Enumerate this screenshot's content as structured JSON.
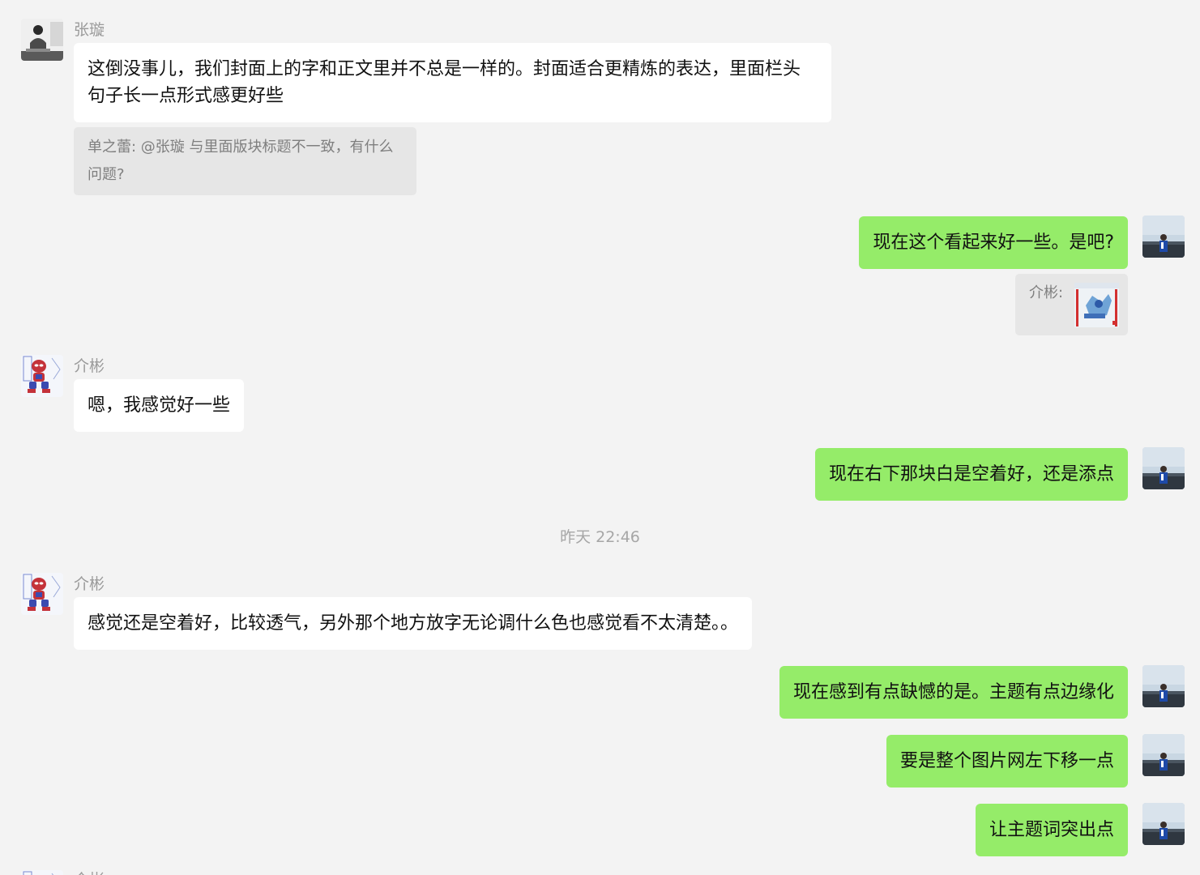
{
  "messages": {
    "m1": {
      "sender": "张璇",
      "text": "这倒没事儿，我们封面上的字和正文里并不总是一样的。封面适合更精炼的表达，里面栏头句子长一点形式感更好些"
    },
    "q1": {
      "text": "单之蕾: @张璇 与里面版块标题不一致，有什么问题?"
    },
    "m2": {
      "text": "现在这个看起来好一些。是吧?"
    },
    "q2": {
      "label": "介彬:"
    },
    "m3": {
      "sender": "介彬",
      "text": "嗯，我感觉好一些"
    },
    "m4": {
      "text": "现在右下那块白是空着好，还是添点"
    },
    "timestamp": "昨天 22:46",
    "m5": {
      "sender": "介彬",
      "text": "感觉还是空着好，比较透气，另外那个地方放字无论调什么色也感觉看不太清楚。。"
    },
    "m6": {
      "text": "现在感到有点缺憾的是。主题有点边缘化"
    },
    "m7": {
      "text": "要是整个图片网左下移一点"
    },
    "m8": {
      "text": "让主题词突出点"
    },
    "m9": {
      "sender": "介彬"
    }
  },
  "colors": {
    "background": "#f3f3f3",
    "incoming_bubble": "#ffffff",
    "outgoing_bubble": "#95ec69",
    "quote_bg": "#e6e6e6",
    "meta_text": "#9a9a9a"
  }
}
